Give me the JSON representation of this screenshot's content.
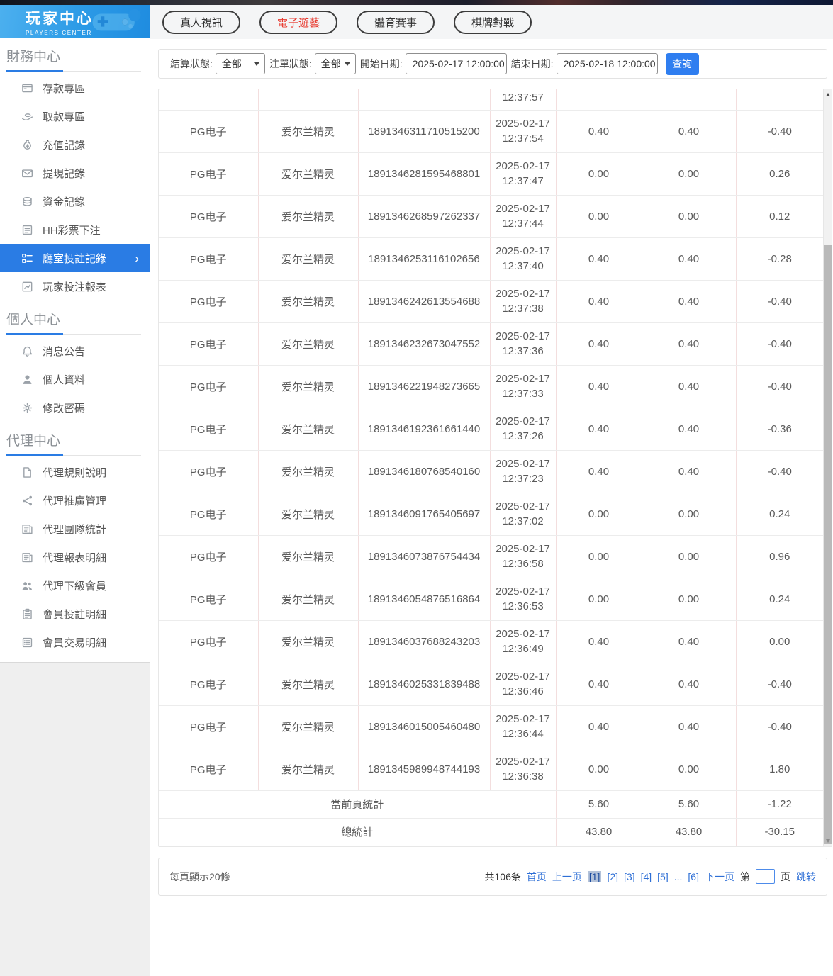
{
  "brand": {
    "title": "玩家中心",
    "subtitle": "PLAYERS CENTER"
  },
  "sidebar": {
    "sections": [
      {
        "title": "財務中心",
        "items": [
          {
            "icon": "card-icon",
            "label": "存款專區"
          },
          {
            "icon": "hand-coins-icon",
            "label": "取款專區"
          },
          {
            "icon": "money-bag-icon",
            "label": "充值記錄"
          },
          {
            "icon": "envelope-icon",
            "label": "提現記錄"
          },
          {
            "icon": "coins-icon",
            "label": "資金記錄"
          },
          {
            "icon": "document-icon",
            "label": "HH彩票下注"
          },
          {
            "icon": "room-records-icon",
            "label": "廳室投註記錄",
            "active": true
          },
          {
            "icon": "chart-report-icon",
            "label": "玩家投注報表"
          }
        ]
      },
      {
        "title": "個人中心",
        "items": [
          {
            "icon": "bell-icon",
            "label": "消息公告"
          },
          {
            "icon": "person-icon",
            "label": "個人資料"
          },
          {
            "icon": "gear-icon",
            "label": "修改密碼"
          }
        ]
      },
      {
        "title": "代理中心",
        "items": [
          {
            "icon": "file-icon",
            "label": "代理規則說明"
          },
          {
            "icon": "share-icon",
            "label": "代理推廣管理"
          },
          {
            "icon": "report-icon",
            "label": "代理團隊統計"
          },
          {
            "icon": "report-icon",
            "label": "代理報表明細"
          },
          {
            "icon": "users-icon",
            "label": "代理下級會員"
          },
          {
            "icon": "clipboard-icon",
            "label": "會員投註明細"
          },
          {
            "icon": "list-icon",
            "label": "會員交易明細"
          }
        ]
      }
    ]
  },
  "tabs": [
    {
      "label": "真人視訊"
    },
    {
      "label": "電子遊藝",
      "active": true
    },
    {
      "label": "體育賽事"
    },
    {
      "label": "棋牌對戰"
    }
  ],
  "filters": {
    "settle_status_label": "結算狀態:",
    "settle_status_value": "全部",
    "order_status_label": "注單狀態:",
    "order_status_value": "全部",
    "start_date_label": "開始日期:",
    "start_date_value": "2025-02-17 12:00:00",
    "end_date_label": "結束日期:",
    "end_date_value": "2025-02-18 12:00:00",
    "search_button": "查詢"
  },
  "table": {
    "partial_row_time": "12:37:57",
    "rows": [
      {
        "provider": "PG电子",
        "game": "爱尔兰精灵",
        "order_id": "1891346311710515200",
        "date": "2025-02-17",
        "time": "12:37:54",
        "bet": "0.40",
        "valid_bet": "0.40",
        "win_loss": "-0.40"
      },
      {
        "provider": "PG电子",
        "game": "爱尔兰精灵",
        "order_id": "1891346281595468801",
        "date": "2025-02-17",
        "time": "12:37:47",
        "bet": "0.00",
        "valid_bet": "0.00",
        "win_loss": "0.26"
      },
      {
        "provider": "PG电子",
        "game": "爱尔兰精灵",
        "order_id": "1891346268597262337",
        "date": "2025-02-17",
        "time": "12:37:44",
        "bet": "0.00",
        "valid_bet": "0.00",
        "win_loss": "0.12"
      },
      {
        "provider": "PG电子",
        "game": "爱尔兰精灵",
        "order_id": "1891346253116102656",
        "date": "2025-02-17",
        "time": "12:37:40",
        "bet": "0.40",
        "valid_bet": "0.40",
        "win_loss": "-0.28"
      },
      {
        "provider": "PG电子",
        "game": "爱尔兰精灵",
        "order_id": "1891346242613554688",
        "date": "2025-02-17",
        "time": "12:37:38",
        "bet": "0.40",
        "valid_bet": "0.40",
        "win_loss": "-0.40"
      },
      {
        "provider": "PG电子",
        "game": "爱尔兰精灵",
        "order_id": "1891346232673047552",
        "date": "2025-02-17",
        "time": "12:37:36",
        "bet": "0.40",
        "valid_bet": "0.40",
        "win_loss": "-0.40"
      },
      {
        "provider": "PG电子",
        "game": "爱尔兰精灵",
        "order_id": "1891346221948273665",
        "date": "2025-02-17",
        "time": "12:37:33",
        "bet": "0.40",
        "valid_bet": "0.40",
        "win_loss": "-0.40"
      },
      {
        "provider": "PG电子",
        "game": "爱尔兰精灵",
        "order_id": "1891346192361661440",
        "date": "2025-02-17",
        "time": "12:37:26",
        "bet": "0.40",
        "valid_bet": "0.40",
        "win_loss": "-0.36"
      },
      {
        "provider": "PG电子",
        "game": "爱尔兰精灵",
        "order_id": "1891346180768540160",
        "date": "2025-02-17",
        "time": "12:37:23",
        "bet": "0.40",
        "valid_bet": "0.40",
        "win_loss": "-0.40"
      },
      {
        "provider": "PG电子",
        "game": "爱尔兰精灵",
        "order_id": "1891346091765405697",
        "date": "2025-02-17",
        "time": "12:37:02",
        "bet": "0.00",
        "valid_bet": "0.00",
        "win_loss": "0.24"
      },
      {
        "provider": "PG电子",
        "game": "爱尔兰精灵",
        "order_id": "1891346073876754434",
        "date": "2025-02-17",
        "time": "12:36:58",
        "bet": "0.00",
        "valid_bet": "0.00",
        "win_loss": "0.96"
      },
      {
        "provider": "PG电子",
        "game": "爱尔兰精灵",
        "order_id": "1891346054876516864",
        "date": "2025-02-17",
        "time": "12:36:53",
        "bet": "0.00",
        "valid_bet": "0.00",
        "win_loss": "0.24"
      },
      {
        "provider": "PG电子",
        "game": "爱尔兰精灵",
        "order_id": "1891346037688243203",
        "date": "2025-02-17",
        "time": "12:36:49",
        "bet": "0.40",
        "valid_bet": "0.40",
        "win_loss": "0.00"
      },
      {
        "provider": "PG电子",
        "game": "爱尔兰精灵",
        "order_id": "1891346025331839488",
        "date": "2025-02-17",
        "time": "12:36:46",
        "bet": "0.40",
        "valid_bet": "0.40",
        "win_loss": "-0.40"
      },
      {
        "provider": "PG电子",
        "game": "爱尔兰精灵",
        "order_id": "1891346015005460480",
        "date": "2025-02-17",
        "time": "12:36:44",
        "bet": "0.40",
        "valid_bet": "0.40",
        "win_loss": "-0.40"
      },
      {
        "provider": "PG电子",
        "game": "爱尔兰精灵",
        "order_id": "1891345989948744193",
        "date": "2025-02-17",
        "time": "12:36:38",
        "bet": "0.00",
        "valid_bet": "0.00",
        "win_loss": "1.80"
      }
    ],
    "summary": [
      {
        "label": "當前頁統計",
        "bet": "5.60",
        "valid_bet": "5.60",
        "win_loss": "-1.22"
      },
      {
        "label": "總統計",
        "bet": "43.80",
        "valid_bet": "43.80",
        "win_loss": "-30.15"
      }
    ]
  },
  "pagination": {
    "per_page": "每頁顯示20條",
    "total": "共106条",
    "first": "首页",
    "prev": "上一页",
    "pages": [
      {
        "label": "[1]",
        "current": true
      },
      {
        "label": "[2]"
      },
      {
        "label": "[3]"
      },
      {
        "label": "[4]"
      },
      {
        "label": "[5]"
      }
    ],
    "ellipsis": "...",
    "last_pages": [
      {
        "label": "[6]"
      }
    ],
    "next": "下一页",
    "jump_prefix": "第",
    "jump_suffix": "页",
    "jump_action": "跳转"
  },
  "colors": {
    "accent_blue": "#2a7ce4",
    "button_blue": "#2f7ef0",
    "active_tab_red": "#e8392e",
    "link_blue": "#2e6fd6"
  }
}
